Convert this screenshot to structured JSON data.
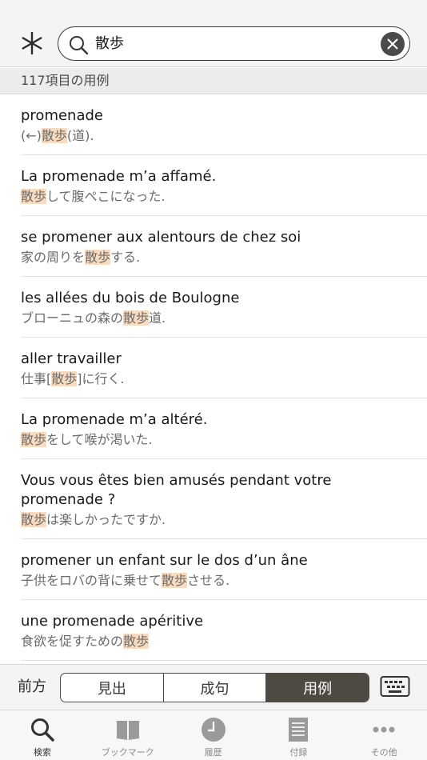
{
  "search": {
    "query": "散歩"
  },
  "header": {
    "count_label": "117項目の用例"
  },
  "results": [
    {
      "fr": "promenade",
      "ja": [
        {
          "t": "(←)",
          "h": false
        },
        {
          "t": "散歩",
          "h": true
        },
        {
          "t": "(道).",
          "h": false
        }
      ]
    },
    {
      "fr": "La promenade m’a affamé.",
      "ja": [
        {
          "t": "散歩",
          "h": true
        },
        {
          "t": "して腹ぺこになった.",
          "h": false
        }
      ]
    },
    {
      "fr": "se promener aux alentours de chez soi",
      "ja": [
        {
          "t": "家の周りを",
          "h": false
        },
        {
          "t": "散歩",
          "h": true
        },
        {
          "t": "する.",
          "h": false
        }
      ]
    },
    {
      "fr": "les allées du bois de Boulogne",
      "ja": [
        {
          "t": "ブローニュの森の",
          "h": false
        },
        {
          "t": "散歩",
          "h": true
        },
        {
          "t": "道.",
          "h": false
        }
      ]
    },
    {
      "fr": "aller travailler",
      "ja": [
        {
          "t": "仕事[",
          "h": false
        },
        {
          "t": "散歩",
          "h": true
        },
        {
          "t": "]に行く.",
          "h": false
        }
      ]
    },
    {
      "fr": "La promenade m’a altéré.",
      "ja": [
        {
          "t": "散歩",
          "h": true
        },
        {
          "t": "をして喉が渇いた.",
          "h": false
        }
      ]
    },
    {
      "fr": "Vous vous êtes bien amusés pendant votre promenade ?",
      "ja": [
        {
          "t": "散歩",
          "h": true
        },
        {
          "t": "は楽しかったですか.",
          "h": false
        }
      ]
    },
    {
      "fr": "promener un enfant sur le dos d’un âne",
      "ja": [
        {
          "t": "子供をロバの背に乗せて",
          "h": false
        },
        {
          "t": "散歩",
          "h": true
        },
        {
          "t": "させる.",
          "h": false
        }
      ]
    },
    {
      "fr": "une promenade apéritive",
      "ja": [
        {
          "t": "食欲を促すための",
          "h": false
        },
        {
          "t": "散歩",
          "h": true
        }
      ]
    }
  ],
  "segment": {
    "label": "前方",
    "options": [
      "見出",
      "成句",
      "用例"
    ],
    "selected": "用例"
  },
  "tabs": [
    {
      "label": "検索",
      "icon": "search-icon",
      "active": true
    },
    {
      "label": "ブックマーク",
      "icon": "book-icon",
      "active": false
    },
    {
      "label": "履歴",
      "icon": "clock-icon",
      "active": false
    },
    {
      "label": "付録",
      "icon": "document-icon",
      "active": false
    },
    {
      "label": "その他",
      "icon": "more-icon",
      "active": false
    }
  ],
  "colors": {
    "highlight": "#f9dcc0",
    "active_segment": "#4d4a42"
  }
}
